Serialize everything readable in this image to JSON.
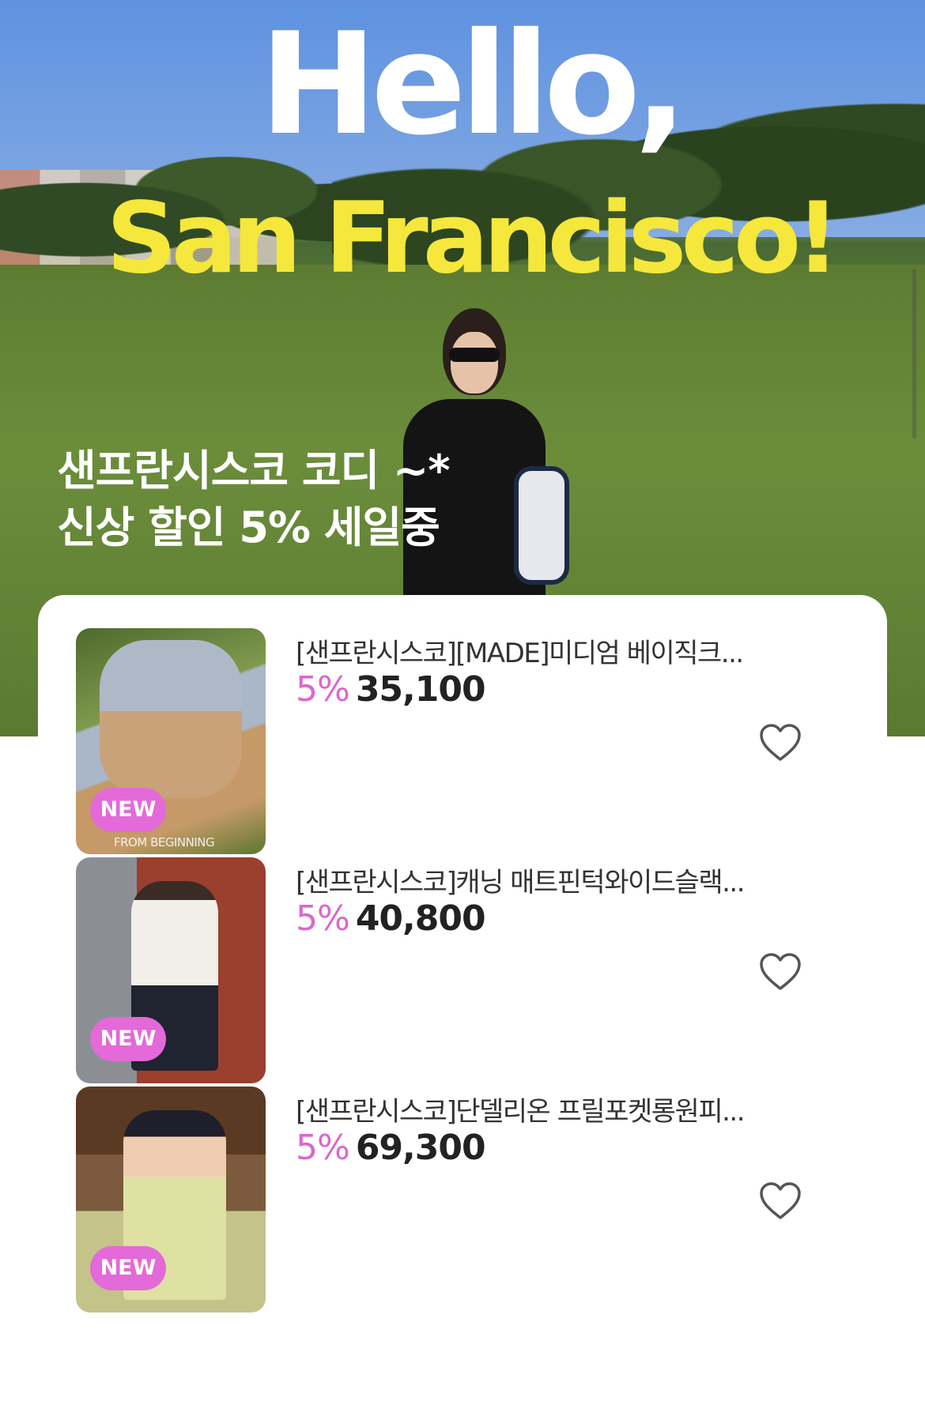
{
  "hero": {
    "title_line1": "Hello,",
    "title_line2": "San Francisco!",
    "subtitle_line1": "샌프란시스코 코디 ~*",
    "subtitle_line2": "신상 할인 5% 세일중"
  },
  "colors": {
    "badge": "#e36ad8",
    "discount": "#dc66cf",
    "hero_title_accent": "#f5e73b"
  },
  "products": [
    {
      "title": "[샌프란시스코][MADE]미디엄 베이직크...",
      "discount": "5%",
      "price": "35,100",
      "badge": "NEW",
      "image_caption": "FROM BEGINNING",
      "icon": "heart-outline-icon"
    },
    {
      "title": "[샌프란시스코]캐닝 매트핀턱와이드슬랙...",
      "discount": "5%",
      "price": "40,800",
      "badge": "NEW",
      "icon": "heart-outline-icon"
    },
    {
      "title": "[샌프란시스코]단델리온 프릴포켓롱원피...",
      "discount": "5%",
      "price": "69,300",
      "badge": "NEW",
      "icon": "heart-outline-icon"
    }
  ]
}
